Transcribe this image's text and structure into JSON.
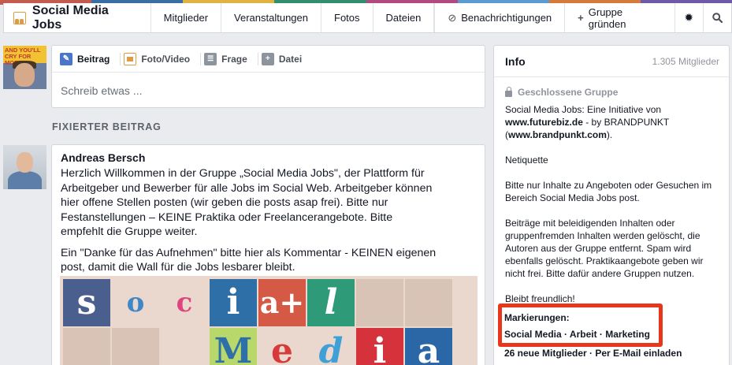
{
  "top_nav": {
    "group_name": "Social Media Jobs",
    "links": [
      "Mitglieder",
      "Veranstaltungen",
      "Fotos",
      "Dateien"
    ],
    "notifications_label": "Benachrichtigungen",
    "create_group_label": "Gruppe gründen"
  },
  "profile_avatar_banner_text": "AND YOU'LL CRY FOR MORE!",
  "composer": {
    "tabs": [
      {
        "label": "Beitrag",
        "icon": "pencil-icon",
        "color": "#4a76c9"
      },
      {
        "label": "Foto/Video",
        "icon": "photo-icon",
        "color": "#e09a43"
      },
      {
        "label": "Frage",
        "icon": "question-list-icon",
        "color": "#8d949e"
      },
      {
        "label": "Datei",
        "icon": "file-add-icon",
        "color": "#8d949e"
      }
    ],
    "placeholder": "Schreib etwas ..."
  },
  "pinned": {
    "section_label": "FIXIERTER BEITRAG",
    "author": "Andreas Bersch",
    "paragraph1_lines": [
      "Herzlich Willkommen in der Gruppe „Social Media Jobs\", der Plattform für",
      "Arbeitgeber und Bewerber für alle Jobs im Social Web. Arbeitgeber können",
      "hier offene Stellen posten (wir geben die posts asap frei). Bitte nur",
      "Festanstellungen – KEINE Praktika oder Freelancerangebote. Bitte",
      "empfehlt die Gruppe weiter."
    ],
    "paragraph2_lines": [
      "Ein \"Danke für das Aufnehmen\" bitte hier als Kommentar - KEINEN eigenen",
      "post, damit die Wall für die Jobs lesbarer bleibt."
    ],
    "image_letters": [
      "s",
      "o",
      "c",
      "i",
      "a+",
      "l",
      "M",
      "e",
      "d",
      "i",
      "a"
    ]
  },
  "info": {
    "title": "Info",
    "member_count": "1.305 Mitglieder",
    "privacy": "Geschlossene Gruppe",
    "desc_line1": "Social Media Jobs: Eine Initiative von",
    "desc_link1": "www.futurebiz.de",
    "desc_mid": " - by BRANDPUNKT",
    "desc_link2": "www.brandpunkt.com",
    "netiquette": "Netiquette",
    "rules1_lines": [
      "Bitte nur Inhalte zu Angeboten oder Gesuchen im",
      "Bereich Social Media Jobs post."
    ],
    "rules2_lines": [
      "Beiträge mit beleidigenden Inhalten oder",
      "gruppenfremden Inhalten werden gelöscht, die",
      "Autoren aus der Gruppe entfernt. Spam wird",
      "ebenfalls gelöscht. Praktikaangebote geben wir",
      "nicht frei. Bitte dafür andere Gruppen nutzen."
    ],
    "closing": "Bleibt freundlich!",
    "tags_label": "Markierungen:",
    "tags": "Social Media · Arbeit · Marketing",
    "new_members": "26 neue Mitglieder · Per E-Mail einladen"
  },
  "colors": {
    "highlight": "#e8361c",
    "accent": "#4a76c9"
  }
}
